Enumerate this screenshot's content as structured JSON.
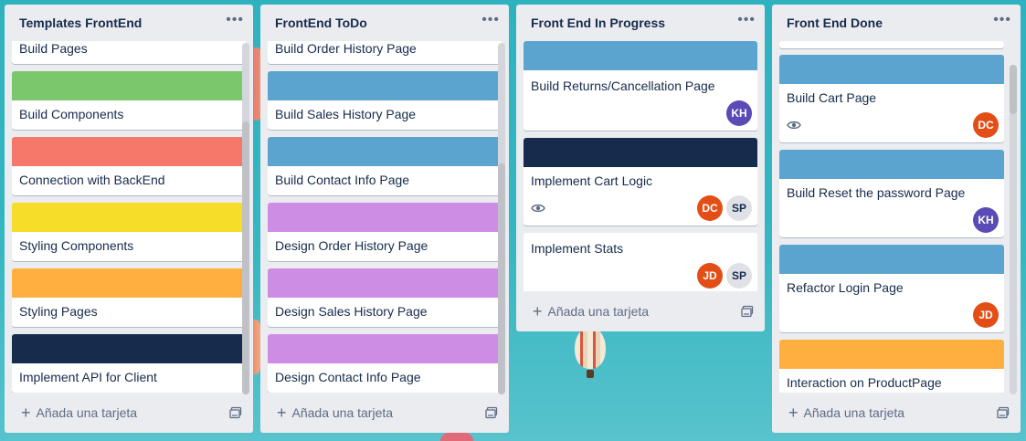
{
  "colors": {
    "green": "#7bc86c",
    "red": "#f5786a",
    "yellow": "#f5dd29",
    "orange": "#ffaf3f",
    "navy": "#172b4d",
    "blue": "#5ba4cf",
    "purple": "#cd8de5",
    "avatar_kh": "#5b4bb7",
    "avatar_dc": "#e34e16",
    "avatar_jd": "#e34e16"
  },
  "add_card_label": "Añada una tarjeta",
  "lists": [
    {
      "title": "Templates FrontEnd",
      "cards": [
        {
          "title": "Build Pages",
          "cover": ""
        },
        {
          "title": "Build Components",
          "cover": "#7bc86c"
        },
        {
          "title": "Connection with BackEnd",
          "cover": "#f5786a"
        },
        {
          "title": "Styling Components",
          "cover": "#f5dd29"
        },
        {
          "title": "Styling Pages",
          "cover": "#ffaf3f"
        },
        {
          "title": "Implement API for Client",
          "cover": "#172b4d"
        }
      ]
    },
    {
      "title": "FrontEnd ToDo",
      "cards": [
        {
          "title": "Build Order History Page",
          "cover": ""
        },
        {
          "title": "Build Sales History Page",
          "cover": "#5ba4cf"
        },
        {
          "title": "Build Contact Info Page",
          "cover": "#5ba4cf"
        },
        {
          "title": "Design Order History Page",
          "cover": "#cd8de5"
        },
        {
          "title": "Design Sales History Page",
          "cover": "#cd8de5"
        },
        {
          "title": "Design Contact Info Page",
          "cover": "#cd8de5"
        }
      ]
    },
    {
      "title": "Front End In Progress",
      "cards": [
        {
          "title": "Build Returns/Cancellation Page",
          "cover": "#5ba4cf",
          "avatars": [
            "KH"
          ]
        },
        {
          "title": "Implement Cart Logic",
          "cover": "#172b4d",
          "watch": true,
          "avatars": [
            "DC",
            "SP"
          ]
        },
        {
          "title": "Implement Stats",
          "cover": "",
          "avatars": [
            "JD",
            "SP"
          ]
        }
      ]
    },
    {
      "title": "Front End Done",
      "cards": [
        {
          "title": "Build Cart Page",
          "cover": "#5ba4cf",
          "watch": true,
          "avatars": [
            "DC"
          ]
        },
        {
          "title": "Build Reset the password Page",
          "cover": "#5ba4cf",
          "avatars": [
            "KH"
          ]
        },
        {
          "title": "Refactor Login Page",
          "cover": "#5ba4cf",
          "avatars": [
            "JD"
          ]
        },
        {
          "title": "Interaction on ProductPage",
          "cover": "#ffaf3f"
        }
      ]
    }
  ]
}
